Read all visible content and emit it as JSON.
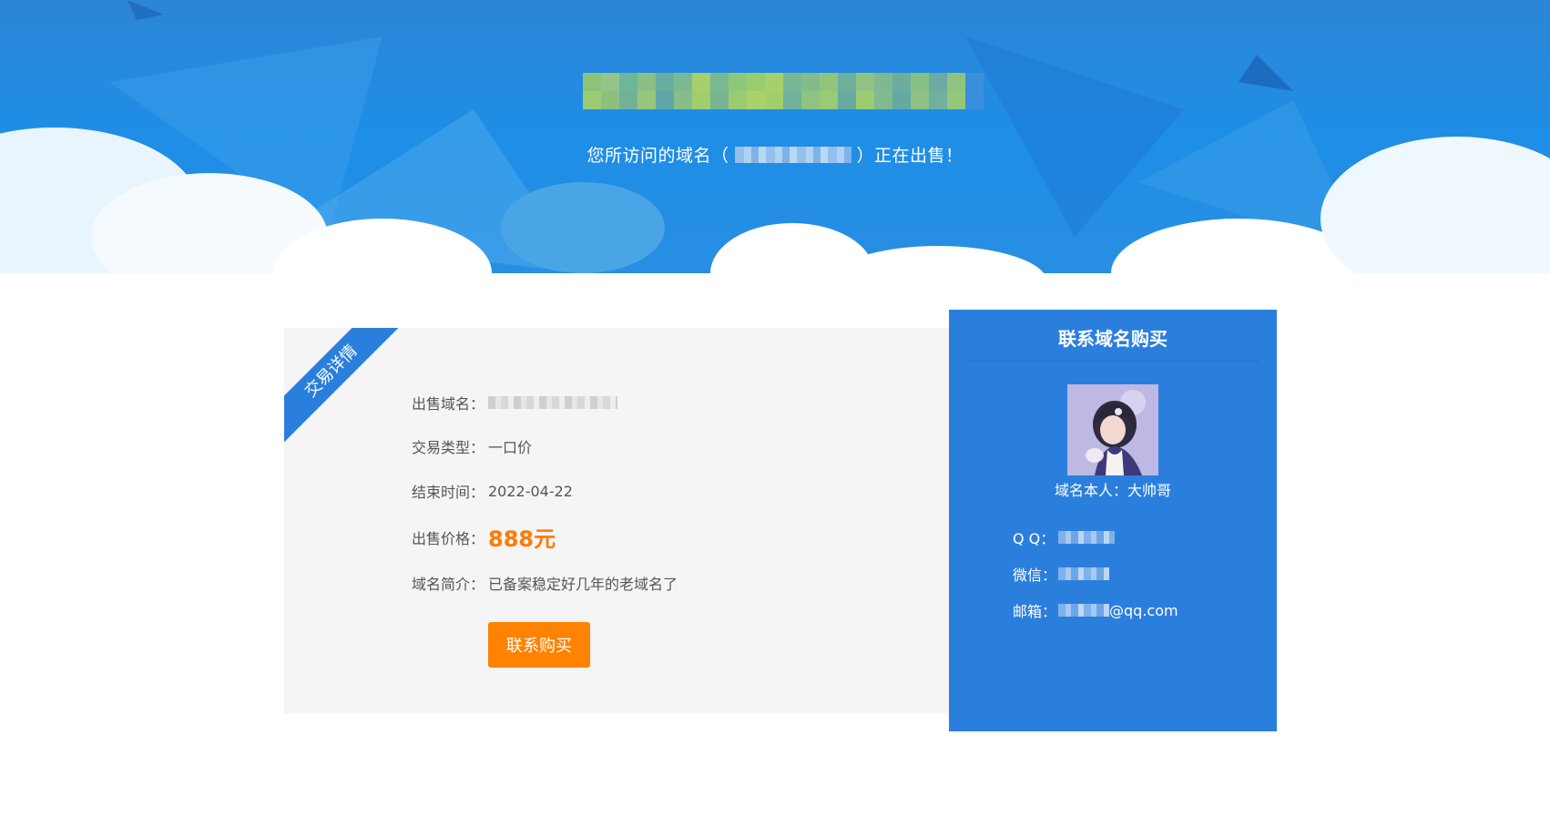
{
  "header": {
    "subtitle_prefix": "您所访问的域名（",
    "subtitle_suffix": "）正在出售！"
  },
  "details": {
    "ribbon_label": "交易详情",
    "rows": [
      {
        "label": "出售域名：",
        "value": ""
      },
      {
        "label": "交易类型：",
        "value": "一口价"
      },
      {
        "label": "结束时间：",
        "value": "2022-04-22"
      },
      {
        "label": "出售价格：",
        "value": "888元"
      },
      {
        "label": "域名简介：",
        "value": "已备案稳定好几年的老域名了"
      }
    ],
    "buy_button_label": "联系购买"
  },
  "contact": {
    "title": "联系域名购买",
    "owner": "域名本人：大帅哥",
    "qq_label": "Q Q：",
    "wechat_label": "微信：",
    "email_label": "邮箱：",
    "email_suffix": "@qq.com"
  },
  "colors": {
    "accent_blue": "#2b7fdc",
    "price_orange": "#ff7a00",
    "button_orange": "#ff8200"
  }
}
